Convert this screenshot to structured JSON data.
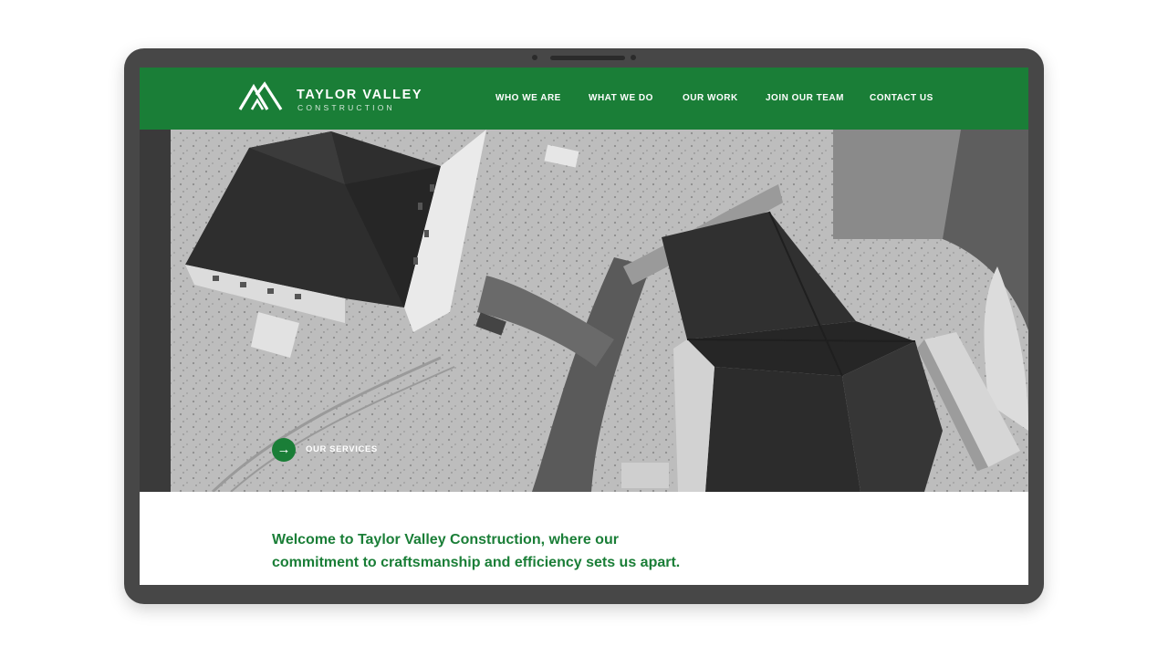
{
  "brand": {
    "name": "TAYLOR VALLEY",
    "tagline": "CONSTRUCTION",
    "logo_icon": "mountain-peaks-icon",
    "color": "#1a7e37"
  },
  "nav": {
    "items": [
      {
        "label": "WHO WE ARE"
      },
      {
        "label": "WHAT WE DO"
      },
      {
        "label": "OUR WORK"
      },
      {
        "label": "JOIN OUR TEAM"
      },
      {
        "label": "CONTACT US"
      }
    ]
  },
  "hero": {
    "image": "aerial-grayscale-construction-site",
    "cta_icon": "arrow-right-icon",
    "cta_label": "OUR SERVICES"
  },
  "intro": {
    "line1": "Welcome to Taylor Valley Construction, where our",
    "line2": "commitment to craftsmanship and efficiency sets us apart."
  }
}
